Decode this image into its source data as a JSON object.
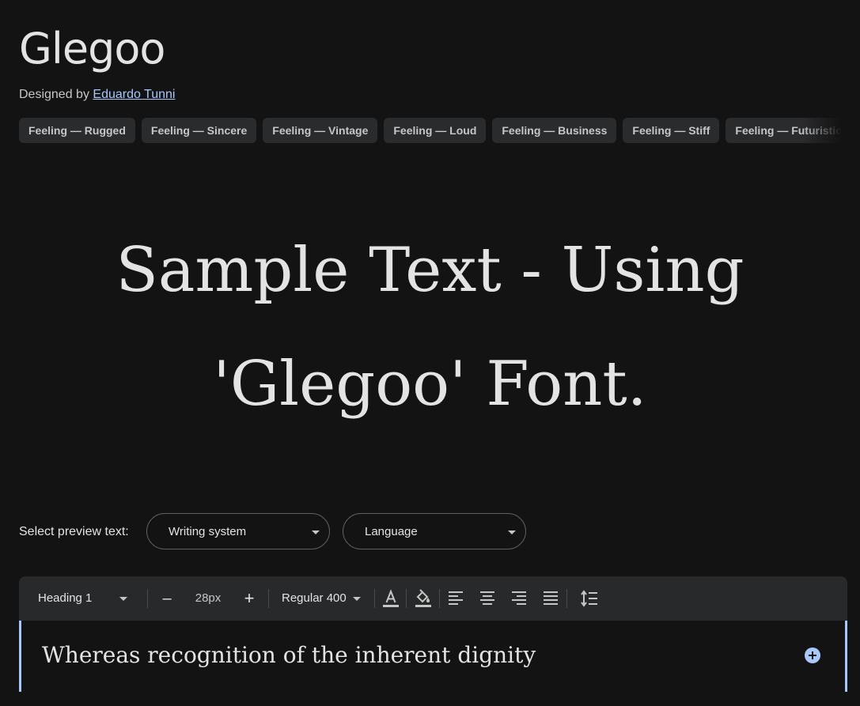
{
  "font": {
    "name": "Glegoo",
    "designed_by_prefix": "Designed by",
    "designer": "Eduardo Tunni"
  },
  "tags": [
    "Feeling — Rugged",
    "Feeling — Sincere",
    "Feeling — Vintage",
    "Feeling — Loud",
    "Feeling — Business",
    "Feeling — Stiff",
    "Feeling — Futuristic"
  ],
  "sample": {
    "line1": "Sample Text - Using",
    "line2": "'Glegoo' Font."
  },
  "preview": {
    "label": "Select preview text:",
    "writing_system": "Writing system",
    "language": "Language"
  },
  "toolbar": {
    "style": "Heading 1",
    "decrease": "–",
    "size": "28px",
    "increase": "+",
    "weight": "Regular 400",
    "icons": [
      "text-color-icon",
      "highlight-color-icon",
      "align-left-icon",
      "align-center-icon",
      "align-right-icon",
      "align-justify-icon",
      "line-height-icon"
    ]
  },
  "editor": {
    "text": "Whereas recognition of the inherent dignity"
  },
  "colors": {
    "background": "#131313",
    "accent": "#a8c7fa",
    "toolbar": "#28292a",
    "chip": "#2a2b2d"
  }
}
